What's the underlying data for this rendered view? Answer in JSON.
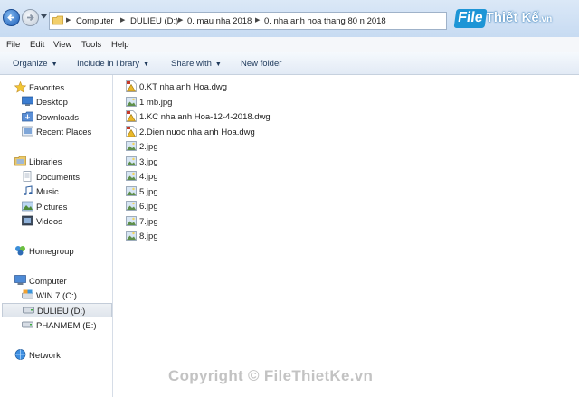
{
  "address": {
    "breadcrumb": [
      "Computer",
      "DULIEU (D:)",
      "0. mau nha 2018",
      "0. nha anh hoa thang 80 n 2018"
    ]
  },
  "brand": {
    "file": "File",
    "rest": "Thiết Kế",
    "tld": ".vn"
  },
  "menu": [
    "File",
    "Edit",
    "View",
    "Tools",
    "Help"
  ],
  "toolbar": {
    "organize": "Organize",
    "include": "Include in library",
    "share": "Share with",
    "new_folder": "New folder"
  },
  "nav": {
    "favorites": "Favorites",
    "desktop": "Desktop",
    "downloads": "Downloads",
    "recent": "Recent Places",
    "libraries": "Libraries",
    "documents": "Documents",
    "music": "Music",
    "pictures": "Pictures",
    "videos": "Videos",
    "homegroup": "Homegroup",
    "computer": "Computer",
    "win7": "WIN 7 (C:)",
    "dulieu": "DULIEU (D:)",
    "phanmem": "PHANMEM (E:)",
    "network": "Network"
  },
  "files": [
    {
      "name": "0.KT nha anh Hoa.dwg",
      "type": "dwg"
    },
    {
      "name": "1 mb.jpg",
      "type": "jpg"
    },
    {
      "name": "1.KC nha anh Hoa-12-4-2018.dwg",
      "type": "dwg"
    },
    {
      "name": "2.Dien nuoc nha anh Hoa.dwg",
      "type": "dwg"
    },
    {
      "name": "2.jpg",
      "type": "jpg"
    },
    {
      "name": "3.jpg",
      "type": "jpg"
    },
    {
      "name": "4.jpg",
      "type": "jpg"
    },
    {
      "name": "5.jpg",
      "type": "jpg"
    },
    {
      "name": "6.jpg",
      "type": "jpg"
    },
    {
      "name": "7.jpg",
      "type": "jpg"
    },
    {
      "name": "8.jpg",
      "type": "jpg"
    }
  ],
  "watermark": "Copyright © FileThietKe.vn",
  "colors": {
    "selected_bg": "#dfe5ec",
    "toolbar_text": "#1e395b",
    "brand_blue": "#1d95d6"
  }
}
